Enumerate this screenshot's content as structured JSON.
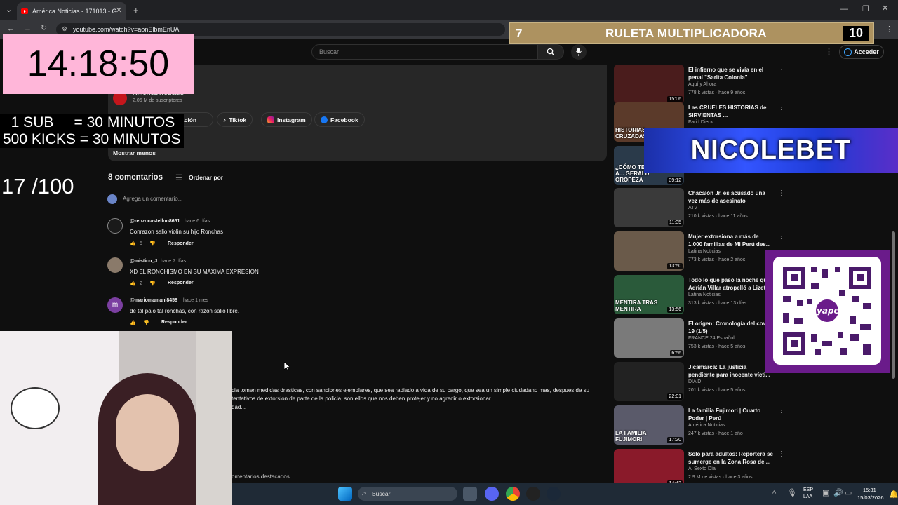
{
  "browser": {
    "tab_title": "América Noticias - 171013 - Gr",
    "url": "youtube.com/watch?v=aonElbmEnUA"
  },
  "youtube": {
    "search_placeholder": "Buscar",
    "signin": "Acceder"
  },
  "channel": {
    "name": "América Noticias",
    "subs": "2.06 M de suscriptores",
    "more_info": "formación",
    "show_less": "Mostrar menos",
    "links": [
      {
        "label": "Tiktok",
        "icon": "tiktok-icon"
      },
      {
        "label": "Instagram",
        "icon": "instagram-icon"
      },
      {
        "label": "Facebook",
        "icon": "facebook-icon"
      }
    ]
  },
  "comments": {
    "count_label": "8 comentarios",
    "sort_label": "Ordenar por",
    "add_placeholder": "Agrega un comentario...",
    "reply": "Responder",
    "items": [
      {
        "user": "@renzocastellon8651",
        "time": "hace 6 días",
        "text": "Conrazon salio violin su hijo Ronchas",
        "likes": "5"
      },
      {
        "user": "@mistico_J",
        "time": "hace 7 días",
        "text": "XD EL RONCHISMO EN SU MAXIMA EXPRESION",
        "likes": "2"
      },
      {
        "user": "@mariomamani8458",
        "time": "hace 1 mes",
        "text": "de tal palo tal ronchas, con razon salio libre.",
        "likes": ""
      }
    ],
    "partial": [
      "cia tomen medidas drasticas, con sanciones ejemplares, que sea radiado a vida de su cargo, que sea un simple ciudadano mas, despues de su",
      "tentativos de extorsion de parte de la policia, son ellos que nos deben protejer y no agredir o extorsionar.",
      "dad..."
    ],
    "featured": "omentarios destacados"
  },
  "sidebar": [
    {
      "title": "El infierno que se vivía en el penal \"Sarita Colonia\"",
      "channel": "Aquí y Ahora",
      "meta": "778 k vistas · hace 9 años",
      "duration": "15:06",
      "color": "#4a1c1c"
    },
    {
      "title": "Las CRUELES HISTORIAS de SIRVIENTAS ...",
      "channel": "Farid Dieck",
      "meta": "",
      "duration": "",
      "color": "#5b3a2a",
      "badge": "HISTORIAS CRUZADAS"
    },
    {
      "title": "",
      "channel": "",
      "meta": "873 k vistas · hace 2 meses",
      "duration": "39:12",
      "color": "#2a3a4a",
      "badge": "¿CÓMO TERMINÓ A...  GERALD OROPEZA"
    },
    {
      "title": "Chacalón Jr. es acusado una vez más de asesinato",
      "channel": "ATV",
      "meta": "210 k vistas · hace 11 años",
      "duration": "11:35",
      "color": "#3a3a3a"
    },
    {
      "title": "Mujer extorsiona a más de 1.000 familias de Mi Perú des...",
      "channel": "Latina Noticias",
      "meta": "773 k vistas · hace 2 años",
      "duration": "13:50",
      "color": "#6a5a4a"
    },
    {
      "title": "Todo lo que pasó la noche qu Adrián Villar atropelló a Lizet",
      "channel": "Latina Noticias",
      "meta": "313 k vistas · hace 13 días",
      "duration": "13:56",
      "color": "#2a5a3a",
      "badge": "MENTIRA TRAS MENTIRA"
    },
    {
      "title": "El origen: Cronología del covi 19 (1/5)",
      "channel": "FRANCE 24 Español",
      "meta": "753 k vistas · hace 5 años",
      "duration": "6:56",
      "color": "#7a7a7a"
    },
    {
      "title": "Jicamarca: La justicia pendiente para inocente vícti...",
      "channel": "DIA D",
      "meta": "201 k vistas · hace 5 años",
      "duration": "22:01",
      "color": "#222"
    },
    {
      "title": "La familia Fujimori | Cuarto Poder | Perú",
      "channel": "América Noticias",
      "meta": "247 k vistas · hace 1 año",
      "duration": "17:20",
      "color": "#5a5a6a",
      "badge": "LA FAMILIA FUJIMORI"
    },
    {
      "title": "Solo para adultos: Reportera se sumerge en la Zona Rosa de ...",
      "channel": "Al Sexto Día",
      "meta": "2.9 M de vistas · hace 3 años",
      "duration": "14:43",
      "color": "#8a1a2a"
    }
  ],
  "overlay": {
    "clock": "14:18:50",
    "sub_rates": "  1 SUB     = 30 MINUTOS\n500 KICKS = 30 MINUTOS",
    "counter": "17 /100",
    "ruleta_left": "7",
    "ruleta_title": "RULETA MULTIPLICADORA",
    "ruleta_right": "10",
    "sponsor": "NICOLEBET",
    "yape": "yape"
  },
  "taskbar": {
    "search": "Buscar",
    "lang": "ESP",
    "layout": "LAA",
    "time": "15:31",
    "date": "15/03/2026"
  }
}
